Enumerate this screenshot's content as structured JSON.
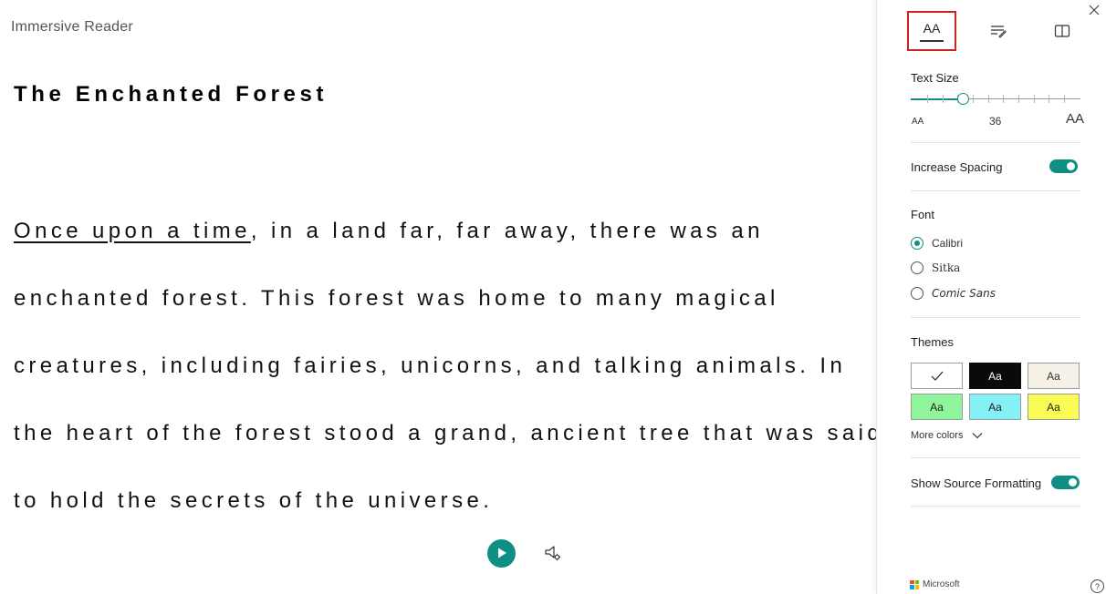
{
  "app": {
    "title": "Immersive Reader"
  },
  "document": {
    "title": "The Enchanted Forest",
    "lines": [
      {
        "highlight": "Once upon a time",
        "rest": ", in a land far, far away, there was an"
      },
      {
        "text": "enchanted forest. This forest was home to many magical"
      },
      {
        "text": "creatures, including fairies, unicorns, and talking animals. In"
      },
      {
        "text": "the heart of the forest stood a grand, ancient tree that was said"
      },
      {
        "text": "to hold the secrets of the universe."
      }
    ]
  },
  "playback": {
    "play_icon": "play-icon",
    "voice_settings_icon": "voice-settings-icon"
  },
  "panel": {
    "tabs": [
      {
        "name": "text-preferences",
        "glyph": "AA",
        "active": true
      },
      {
        "name": "grammar-options",
        "icon": "grammar-icon"
      },
      {
        "name": "reading-preferences",
        "icon": "book-icon"
      }
    ],
    "text_size": {
      "label": "Text Size",
      "value": "36",
      "small_glyph": "AA",
      "large_glyph": "AA",
      "level_fraction": 0.31,
      "tick_count": 10
    },
    "increase_spacing": {
      "label": "Increase Spacing",
      "on": true
    },
    "font": {
      "label": "Font",
      "options": [
        "Calibri",
        "Sitka",
        "Comic Sans"
      ],
      "selected": "Calibri"
    },
    "themes": {
      "label": "Themes",
      "swatch_text": "Aa",
      "swatches": [
        {
          "bg": "#ffffff",
          "fg": "#000000",
          "selected": true
        },
        {
          "bg": "#0a0a0a",
          "fg": "#ffffff"
        },
        {
          "bg": "#f6f1e6",
          "fg": "#333333"
        },
        {
          "bg": "#8ef59b",
          "fg": "#222222"
        },
        {
          "bg": "#86f0f7",
          "fg": "#222222"
        },
        {
          "bg": "#fbfb55",
          "fg": "#222222"
        }
      ],
      "more_colors": "More colors"
    },
    "show_source_formatting": {
      "label": "Show Source Formatting",
      "on": true
    },
    "footer": {
      "brand": "Microsoft",
      "help": "?"
    }
  },
  "colors": {
    "accent": "#0f8f83",
    "active_tab_border": "#d21f1f"
  }
}
